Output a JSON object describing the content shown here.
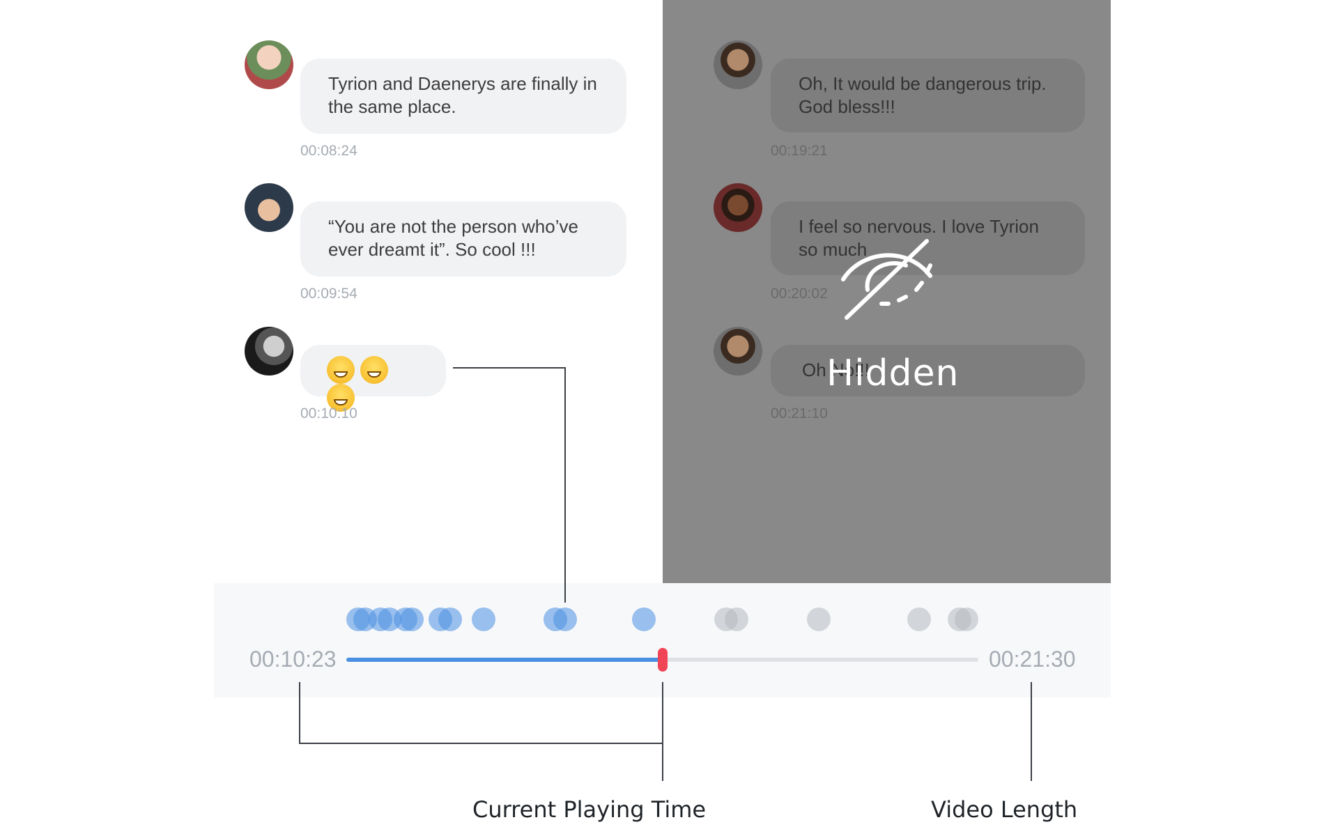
{
  "messages": [
    {
      "text": "Tyrion and Daenerys are finally in the same place.",
      "time": "00:08:24",
      "avatar": "avatar-girl"
    },
    {
      "text": "“You are not the person who’ve ever dreamt it”. So cool !!!",
      "time": "00:09:54",
      "avatar": "avatar-boy"
    },
    {
      "text": "",
      "emoji_count": 3,
      "emoji": "grinning-face-icon",
      "time": "00:10:10",
      "avatar": "avatar-man-bw"
    }
  ],
  "hidden_messages": [
    {
      "text": "Oh, It would be dangerous trip. God bless!!!",
      "time": "00:19:21"
    },
    {
      "text": "I feel so nervous. I love Tyrion so much",
      "time": "00:20:02"
    },
    {
      "text": "Oh No!!!",
      "time": "00:21:10"
    }
  ],
  "hidden_label": "Hidden",
  "hidden_icon": "eye-slash-icon",
  "timeline": {
    "current_time": "00:10:23",
    "video_length": "00:21:30",
    "progress": 0.5
  },
  "captions": {
    "current": "Current Playing Time",
    "length": "Video Length"
  },
  "colors": {
    "accent": "#4a90e2",
    "scrubber": "#f04556",
    "hidden_overlay": "#898989"
  }
}
